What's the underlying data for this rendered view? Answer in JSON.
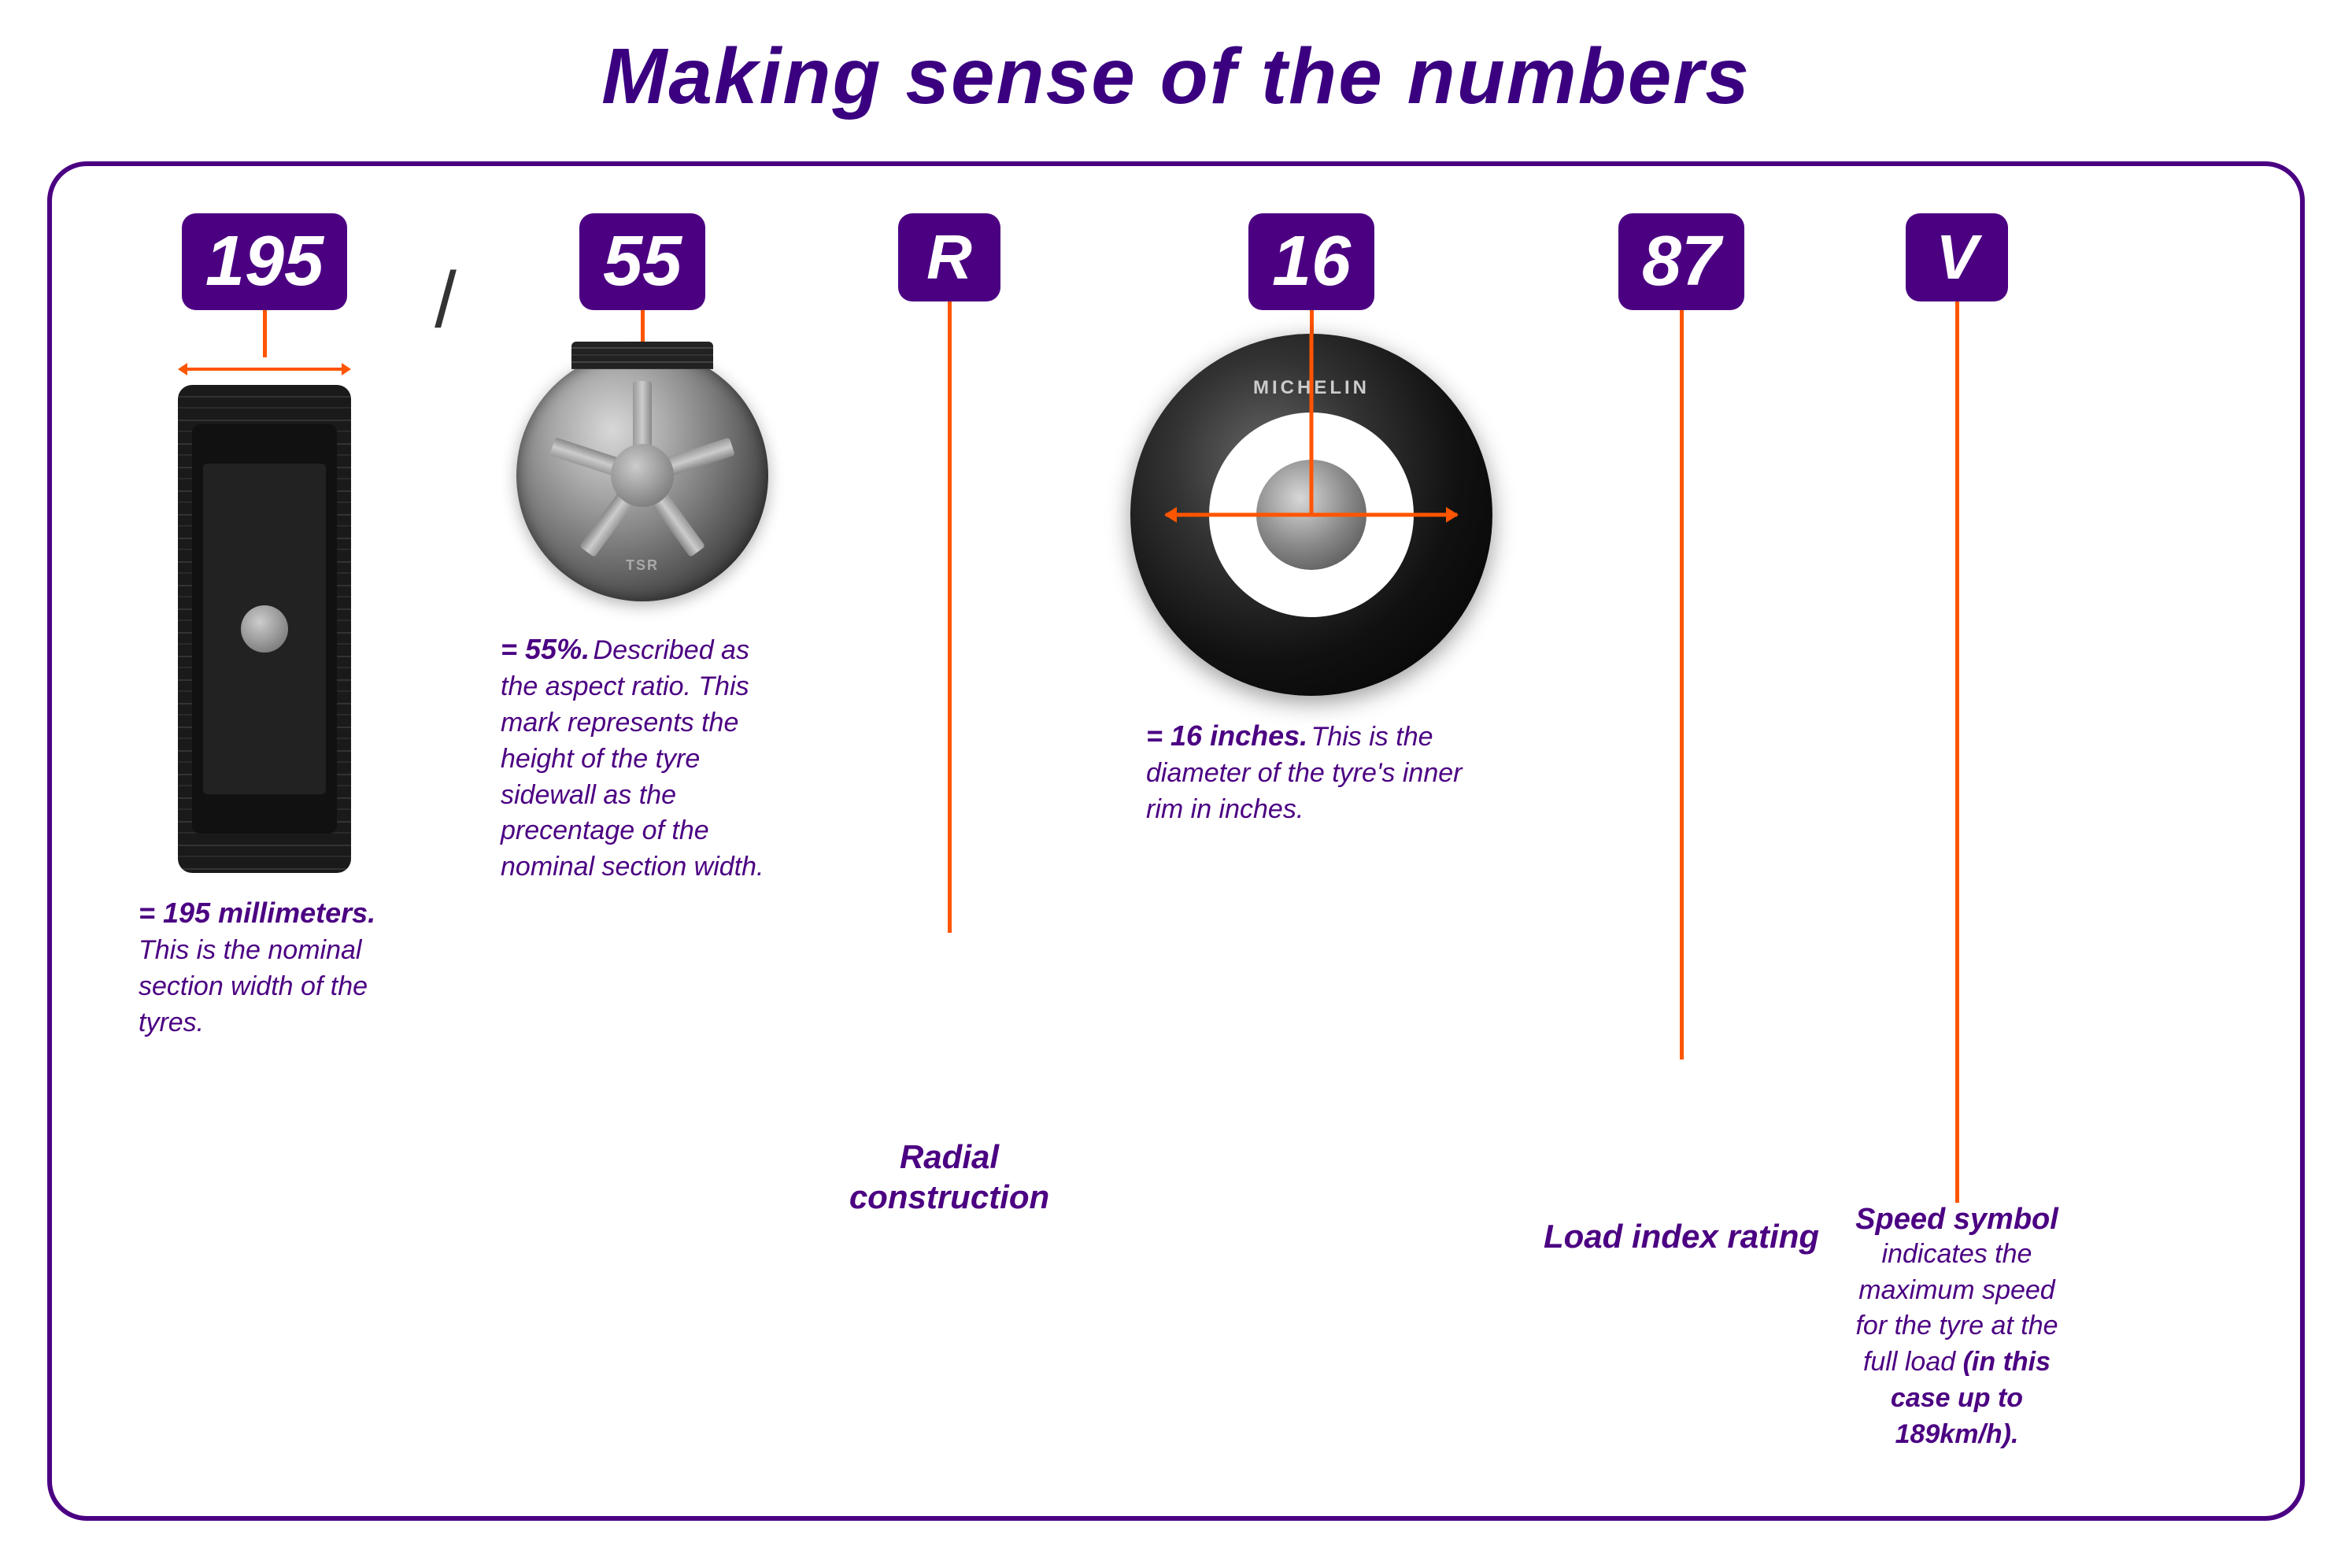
{
  "title": "Making sense of the numbers",
  "sections": {
    "width": {
      "badge": "195",
      "slash": "/",
      "desc_bold": "= 195 millimeters.",
      "desc_normal": "This is the nominal section width of the tyres."
    },
    "aspect": {
      "badge": "55",
      "desc_bold": "= 55%.",
      "desc_normal": " Described as the aspect ratio. This mark represents the height of the tyre sidewall as the precentage of the nominal section width."
    },
    "construction": {
      "badge": "R",
      "desc": "Radial construction"
    },
    "diameter": {
      "badge": "16",
      "brand": "MICHELIN",
      "desc_bold": "= 16 inches.",
      "desc_normal": " This is the diameter of the tyre's inner rim in inches."
    },
    "load": {
      "badge": "87",
      "desc": "Load index rating"
    },
    "speed": {
      "badge": "V",
      "desc_bold": "Speed symbol",
      "desc_normal": " indicates the maximum speed for the tyre at the full load ",
      "desc_emphasis": "(in this case up to 189km/h)."
    }
  }
}
